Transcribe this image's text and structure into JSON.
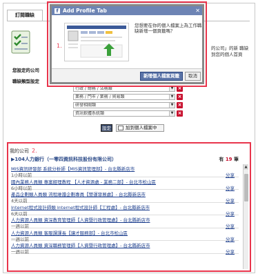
{
  "tab": {
    "label": "訂閱職缺"
  },
  "settings": {
    "right_text": "的公司」的新 職缺到您的個人首頁",
    "your_company_label": "您設定的公司",
    "settings_label": "職缺類型設定",
    "categories": [
      "行政 / 總務 / 法務類",
      "業務 / 門市 / 業務 / 貿易類",
      "研發相關類",
      "資訊軟體系統類"
    ],
    "set_button": "設定",
    "add_tab_button": "加到個人檔案中"
  },
  "modal": {
    "title": "Add Profile Tab",
    "message": "您想要在你的個人檔案上為工作職缺新增一個頁籤嗎？",
    "add_button": "新增個人檔案頁籤",
    "cancel_button": "取消"
  },
  "annotations": {
    "one": "1.",
    "two": "2."
  },
  "company": {
    "section_label": "我的公司",
    "header_name": "▶104人力銀行（一零四資訊科技股份有限公司）",
    "count_prefix": "有",
    "count_value": "19",
    "count_suffix": "筆",
    "jobs": [
      {
        "title": "MIS資訊研發部 系統分析師【MIS資訊管理部】- 台北縣新店市",
        "time": "1小時以前",
        "share": "分享"
      },
      {
        "title": "國內業務人員類 專案經理教程 【人才資源處 - 業務二部】- 台北市松山區",
        "time": "6小時以前",
        "share": "分享"
      },
      {
        "title": "產品企劃類人員類 流程維護企劃專員【營運發展處】- 台北縣新店市",
        "time": "4天以前",
        "share": "分享"
      },
      {
        "title": "Internet程式設計師類 Internet程式設計師【工程處】- 台北縣新店市",
        "time": "6天以前",
        "share": "分享"
      },
      {
        "title": "人力資源人員類 資深教育管理師【人資暨行政管理處】- 台北縣新店市",
        "time": "一週以前",
        "share": "分享"
      },
      {
        "title": "人力資源人員類 客服課課長【讓才服務部】- 台北市松山區",
        "time": "一週以前",
        "share": "分享"
      },
      {
        "title": "人力資源人員類 資深職務管理師【人資暨行政管理處】- 台北縣新店市",
        "time": "一週以前",
        "share": "分享"
      }
    ]
  }
}
